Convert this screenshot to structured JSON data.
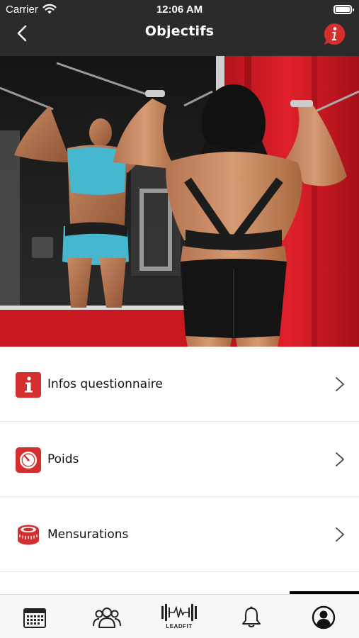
{
  "status_bar": {
    "carrier": "Carrier",
    "time": "12:06 AM"
  },
  "header": {
    "title": "Objectifs",
    "back_icon": "chevron-left-icon",
    "info_icon": "info-icon"
  },
  "hero": {
    "image": "gym-photo",
    "description_icon": "photo"
  },
  "menu": {
    "items": [
      {
        "label": "Infos questionnaire",
        "icon": "info-icon"
      },
      {
        "label": "Poids",
        "icon": "scale-icon"
      },
      {
        "label": "Mensurations",
        "icon": "tape-measure-icon"
      }
    ]
  },
  "tabbar": {
    "tabs": [
      {
        "name": "calendar",
        "icon": "calendar-icon"
      },
      {
        "name": "community",
        "icon": "users-icon"
      },
      {
        "name": "home",
        "icon": "logo",
        "logo_text": "LEADFIT"
      },
      {
        "name": "notifications",
        "icon": "bell-icon"
      },
      {
        "name": "profile",
        "icon": "profile-icon"
      }
    ],
    "active_index": 4
  },
  "colors": {
    "header_bg": "#2b2b2b",
    "accent_red": "#d32f2f",
    "text": "#111111"
  }
}
